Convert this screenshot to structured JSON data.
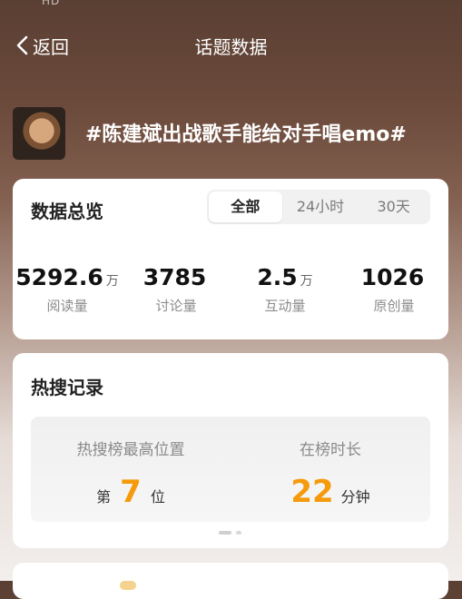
{
  "status_bar": {
    "glyphs": "HD"
  },
  "nav": {
    "back_label": "返回",
    "title": "话题数据"
  },
  "topic": {
    "title": "#陈建斌出战歌手能给对手唱emo#"
  },
  "overview": {
    "title": "数据总览",
    "tabs": [
      {
        "label": "全部",
        "active": true
      },
      {
        "label": "24小时",
        "active": false
      },
      {
        "label": "30天",
        "active": false
      }
    ],
    "stats": [
      {
        "value": "5292.6",
        "unit": "万",
        "label": "阅读量"
      },
      {
        "value": "3785",
        "unit": "",
        "label": "讨论量"
      },
      {
        "value": "2.5",
        "unit": "万",
        "label": "互动量"
      },
      {
        "value": "1026",
        "unit": "",
        "label": "原创量"
      }
    ]
  },
  "hot_search": {
    "title": "热搜记录",
    "highest_position": {
      "label": "热搜榜最高位置",
      "prefix": "第",
      "value": "7",
      "suffix": "位"
    },
    "duration": {
      "label": "在榜时长",
      "value": "22",
      "suffix": "分钟"
    }
  },
  "colors": {
    "accent": "#f59a0a",
    "card_bg": "#ffffff",
    "muted_text": "#8c8c8c"
  }
}
